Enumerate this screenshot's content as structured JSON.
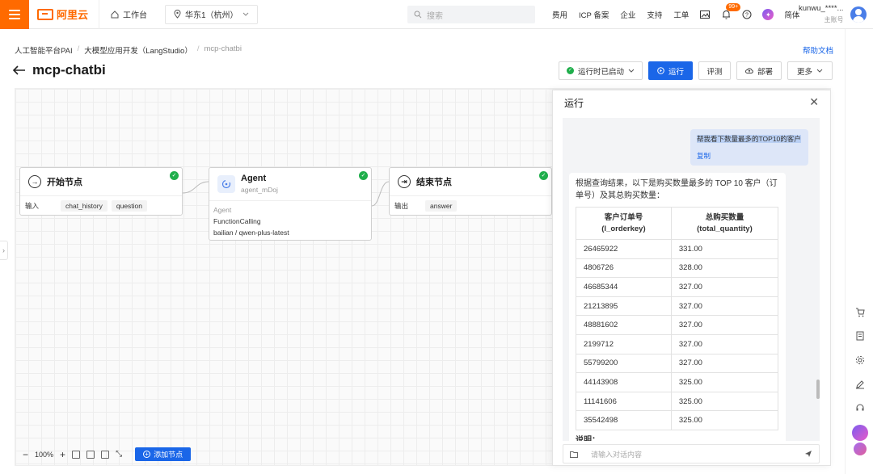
{
  "topbar": {
    "logo_text": "阿里云",
    "workbench": "工作台",
    "region": "华东1（杭州）",
    "search_placeholder": "搜索",
    "nav": [
      "费用",
      "ICP 备案",
      "企业",
      "支持",
      "工单"
    ],
    "badge": "99+",
    "lang": "简体",
    "user_name": "kunwu_****...",
    "user_sub": "主账号",
    "accent": "#ff6a00"
  },
  "breadcrumb": [
    "人工智能平台PAI",
    "大模型应用开发（LangStudio）",
    "mcp-chatbi"
  ],
  "help_link": "帮助文档",
  "page_title": "mcp-chatbi",
  "actions": {
    "runtime": "运行时已启动",
    "run": "运行",
    "evaluate": "评测",
    "deploy": "部署",
    "more": "更多"
  },
  "nodes": {
    "start": {
      "title": "开始节点",
      "row_label": "输入",
      "tags": [
        "chat_history",
        "question"
      ]
    },
    "agent": {
      "title": "Agent",
      "subtitle": "agent_mDoj",
      "section_label": "Agent",
      "line1": "FunctionCalling",
      "line2": "bailian / qwen-plus-latest"
    },
    "end": {
      "title": "结束节点",
      "row_label": "输出",
      "tags": [
        "answer"
      ]
    }
  },
  "toolbar": {
    "zoom": "100%",
    "add_node": "添加节点"
  },
  "panel": {
    "title": "运行",
    "user_message": "帮我看下数量最多的TOP10的客户",
    "copy": "复制",
    "answer_intro": "根据查询结果，以下是购买数量最多的 TOP 10 客户（订单号）及其总购买数量：",
    "table": {
      "headers": [
        "客户订单号 (l_orderkey)",
        "总购买数量 (total_quantity)"
      ],
      "rows": [
        [
          "26465922",
          "331.00"
        ],
        [
          "4806726",
          "328.00"
        ],
        [
          "46685344",
          "327.00"
        ],
        [
          "21213895",
          "327.00"
        ],
        [
          "48881602",
          "327.00"
        ],
        [
          "2199712",
          "327.00"
        ],
        [
          "55799200",
          "327.00"
        ],
        [
          "44143908",
          "325.00"
        ],
        [
          "11141606",
          "325.00"
        ],
        [
          "35542498",
          "325.00"
        ]
      ]
    },
    "note": "说明：",
    "input_placeholder": "请输入对话内容"
  }
}
